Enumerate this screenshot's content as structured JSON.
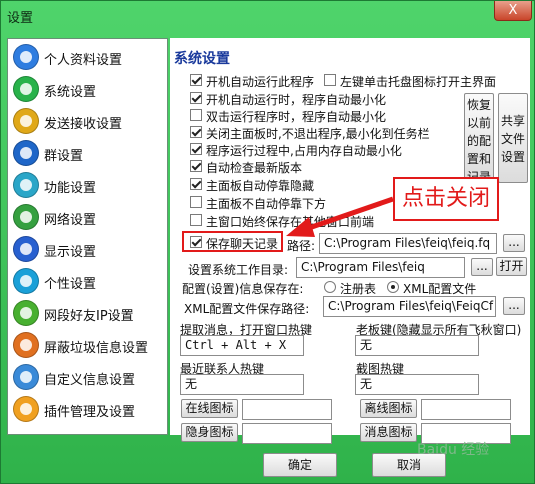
{
  "window": {
    "title": "设置",
    "close_label": "X"
  },
  "sidebar": {
    "items": [
      {
        "label": "个人资料设置",
        "icon": "person-globe-icon",
        "color": "#2f7de0"
      },
      {
        "label": "系统设置",
        "icon": "settings-sparkle-icon",
        "color": "#28b24a"
      },
      {
        "label": "发送接收设置",
        "icon": "send-receive-icon",
        "color": "#e0a818"
      },
      {
        "label": "群设置",
        "icon": "group-globe-icon",
        "color": "#1e66c8"
      },
      {
        "label": "功能设置",
        "icon": "function-rings-icon",
        "color": "#2aa6c8"
      },
      {
        "label": "网络设置",
        "icon": "network-globe-icon",
        "color": "#35a040"
      },
      {
        "label": "显示设置",
        "icon": "display-icon",
        "color": "#2860d0"
      },
      {
        "label": "个性设置",
        "icon": "star-personal-icon",
        "color": "#1aa0d8"
      },
      {
        "label": "网段好友IP设置",
        "icon": "ip-spring-icon",
        "color": "#48b030"
      },
      {
        "label": "屏蔽垃圾信息设置",
        "icon": "block-spam-icon",
        "color": "#e07020"
      },
      {
        "label": "自定义信息设置",
        "icon": "custom-info-icon",
        "color": "#3a8ad8"
      },
      {
        "label": "插件管理及设置",
        "icon": "plugin-icon",
        "color": "#f0a020"
      }
    ]
  },
  "panel": {
    "title": "系统设置",
    "options": [
      {
        "label": "开机自动运行此程序",
        "checked": true
      },
      {
        "label": "左键单击托盘图标打开主界面",
        "checked": false
      },
      {
        "label": "开机自动运行时，程序自动最小化",
        "checked": true
      },
      {
        "label": "双击运行程序时，程序自动最小化",
        "checked": false
      },
      {
        "label": "关闭主面板时,不退出程序,最小化到任务栏",
        "checked": true
      },
      {
        "label": "程序运行过程中,占用内存自动最小化",
        "checked": true
      },
      {
        "label": "自动检查最新版本",
        "checked": true
      },
      {
        "label": "主面板自动停靠隐藏",
        "checked": true
      },
      {
        "label": "主面板不自动停靠下方",
        "checked": false
      },
      {
        "label": "主窗口始终保存在其他窗口前端",
        "checked": false
      },
      {
        "label": "保存聊天记录",
        "checked": true
      }
    ],
    "restore_button": "恢复以前的配置和记录",
    "share_button": "共享文件设置",
    "path_label": "路径:",
    "path_value": "C:\\Program Files\\feiq\\feiq.fq",
    "browse_label": "...",
    "workdir_label": "设置系统工作目录:",
    "workdir_value": "C:\\Program Files\\feiq",
    "open_button": "打开",
    "config_save_label": "配置(设置)信息保存在:",
    "radio_registry": "注册表",
    "radio_xml": "XML配置文件",
    "xml_path_label": "XML配置文件保存路径:",
    "xml_path_value": "C:\\Program Files\\feiq\\FeiqCf",
    "hotkey_open_label": "提取消息，打开窗口热键",
    "hotkey_open_value": "Ctrl + Alt + X",
    "boss_key_label": "老板键(隐藏显示所有飞秋窗口)",
    "boss_key_value": "无",
    "recent_hotkey_label": "最近联系人热键",
    "recent_hotkey_value": "无",
    "capture_hotkey_label": "截图热键",
    "capture_hotkey_value": "无",
    "online_icon_button": "在线图标",
    "offline_icon_button": "离线图标",
    "hidden_icon_button": "隐身图标",
    "message_icon_button": "消息图标"
  },
  "footer": {
    "ok": "确定",
    "cancel": "取消"
  },
  "annotation": {
    "text": "点击关闭",
    "color": "#e21a1a"
  },
  "watermark": "Baidu 经验"
}
